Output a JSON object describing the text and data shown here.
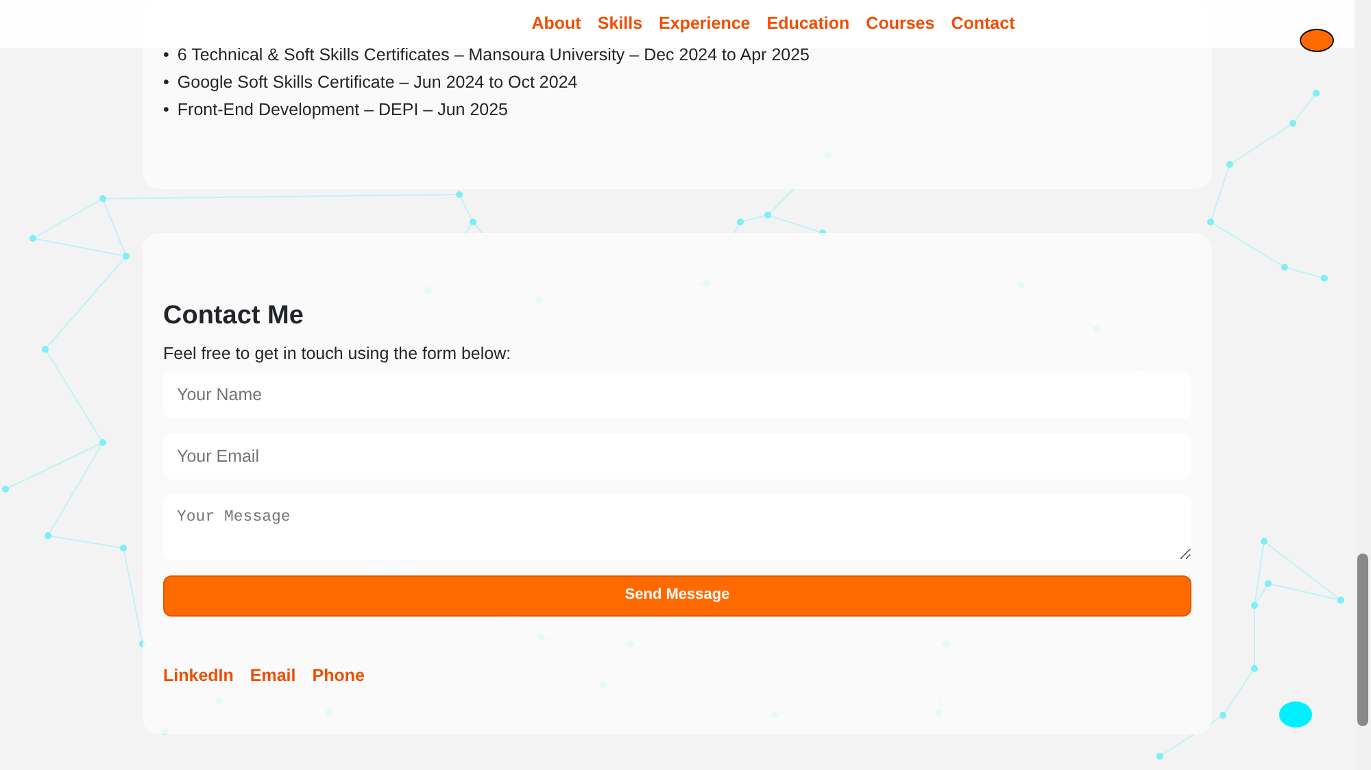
{
  "nav": {
    "links": [
      {
        "label": "About"
      },
      {
        "label": "Skills"
      },
      {
        "label": "Experience"
      },
      {
        "label": "Education"
      },
      {
        "label": "Courses"
      },
      {
        "label": "Contact"
      }
    ]
  },
  "courses": {
    "items": [
      {
        "marker": "•",
        "text": "6 Technical & Soft Skills Certificates – Mansoura University – Dec 2024 to Apr 2025"
      },
      {
        "marker": "•",
        "text": "Google Soft Skills Certificate – Jun 2024 to Oct 2024"
      },
      {
        "marker": "•",
        "text": "Front-End Development – DEPI – Jun 2025"
      }
    ]
  },
  "contact": {
    "title": "Contact Me",
    "intro": "Feel free to get in touch using the form below:",
    "fields": [
      {
        "kind": "input",
        "placeholder": "Your Name"
      },
      {
        "kind": "input",
        "placeholder": "Your Email"
      },
      {
        "kind": "textarea",
        "placeholder": "Your Message"
      }
    ],
    "submit": "Send Message",
    "links": [
      "LinkedIn",
      "Email",
      "Phone"
    ]
  }
}
